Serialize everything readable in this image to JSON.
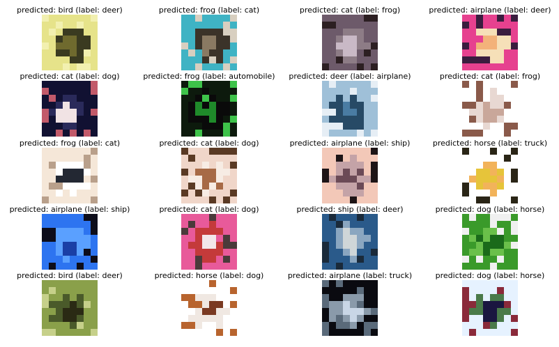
{
  "samples": [
    {
      "caption": "predicted: bird (label: deer)",
      "predicted": "bird",
      "label": "deer",
      "palette": [
        "#e6e38a",
        "#6f6a2e",
        "#f2f0b0",
        "#3a3a20"
      ]
    },
    {
      "caption": "predicted: frog (label: cat)",
      "predicted": "frog",
      "label": "cat",
      "palette": [
        "#3fb3c4",
        "#8a7a63",
        "#d8cfc0",
        "#3b3329"
      ]
    },
    {
      "caption": "predicted: cat (label: frog)",
      "predicted": "cat",
      "label": "frog",
      "palette": [
        "#6d5a6a",
        "#c9b9c6",
        "#2c1f22",
        "#8d7c86"
      ]
    },
    {
      "caption": "predicted: airplane (label: deer)",
      "predicted": "airplane",
      "label": "deer",
      "palette": [
        "#e6418f",
        "#f3b27a",
        "#3a1d3f",
        "#f6e0b8"
      ]
    },
    {
      "caption": "predicted: cat (label: dog)",
      "predicted": "cat",
      "label": "dog",
      "palette": [
        "#111132",
        "#f1e3e4",
        "#c25a6a",
        "#2a2a5a"
      ]
    },
    {
      "caption": "predicted: frog (label: automobile)",
      "predicted": "frog",
      "label": "automobile",
      "palette": [
        "#0d1a0d",
        "#1f8a2a",
        "#3ec34a",
        "#0a0a0a"
      ]
    },
    {
      "caption": "predicted: deer (label: airplane)",
      "predicted": "deer",
      "label": "airplane",
      "palette": [
        "#9fc0d8",
        "#4a7ca3",
        "#e6eef5",
        "#274a66"
      ]
    },
    {
      "caption": "predicted: cat (label: frog)",
      "predicted": "cat",
      "label": "frog",
      "palette": [
        "#ffffff",
        "#c9a79a",
        "#8a5a4a",
        "#e8d8d2"
      ]
    },
    {
      "caption": "predicted: frog (label: cat)",
      "predicted": "frog",
      "label": "cat",
      "palette": [
        "#f5e7d8",
        "#232833",
        "#b9a08b",
        "#ffffff"
      ]
    },
    {
      "caption": "predicted: cat (label: dog)",
      "predicted": "cat",
      "label": "dog",
      "palette": [
        "#f0d6c9",
        "#a76a46",
        "#5a3a24",
        "#f7ece4"
      ]
    },
    {
      "caption": "predicted: airplane (label: ship)",
      "predicted": "airplane",
      "label": "ship",
      "palette": [
        "#f3c8b8",
        "#6b4a56",
        "#1d1416",
        "#c4a3a7"
      ]
    },
    {
      "caption": "predicted: horse (label: truck)",
      "predicted": "horse",
      "label": "truck",
      "palette": [
        "#ffffff",
        "#e6c43a",
        "#2a2516",
        "#f2b35a"
      ]
    },
    {
      "caption": "predicted: airplane (label: ship)",
      "predicted": "airplane",
      "label": "ship",
      "palette": [
        "#2d74f0",
        "#1a3fa6",
        "#0d0d1a",
        "#5aa0ff"
      ]
    },
    {
      "caption": "predicted: cat (label: dog)",
      "predicted": "cat",
      "label": "dog",
      "palette": [
        "#e85a9a",
        "#f2e6ea",
        "#4a3a3a",
        "#c43a3a"
      ]
    },
    {
      "caption": "predicted: ship (label: deer)",
      "predicted": "ship",
      "label": "deer",
      "palette": [
        "#2a5a8a",
        "#cfd6d8",
        "#1a2a3a",
        "#8aa6c0"
      ]
    },
    {
      "caption": "predicted: dog (label: horse)",
      "predicted": "dog",
      "label": "horse",
      "palette": [
        "#3a9a2a",
        "#1a6a1a",
        "#f0f0f0",
        "#6ac04a"
      ]
    },
    {
      "caption": "predicted: bird (label: deer)",
      "predicted": "bird",
      "label": "deer",
      "palette": [
        "#8aa04a",
        "#2a2a14",
        "#c6d08a",
        "#4a5a2a"
      ]
    },
    {
      "caption": "predicted: horse (label: dog)",
      "predicted": "horse",
      "label": "dog",
      "palette": [
        "#ffffff",
        "#7a3a22",
        "#b8642e",
        "#f0e8e2"
      ]
    },
    {
      "caption": "predicted: airplane (label: truck)",
      "predicted": "airplane",
      "label": "truck",
      "palette": [
        "#0a0a10",
        "#c9d6e6",
        "#5a6a7a",
        "#8a9aaa"
      ]
    },
    {
      "caption": "predicted: dog (label: horse)",
      "predicted": "dog",
      "label": "horse",
      "palette": [
        "#e6f2ff",
        "#1a1640",
        "#8a2a3a",
        "#4a7a4a"
      ]
    }
  ]
}
